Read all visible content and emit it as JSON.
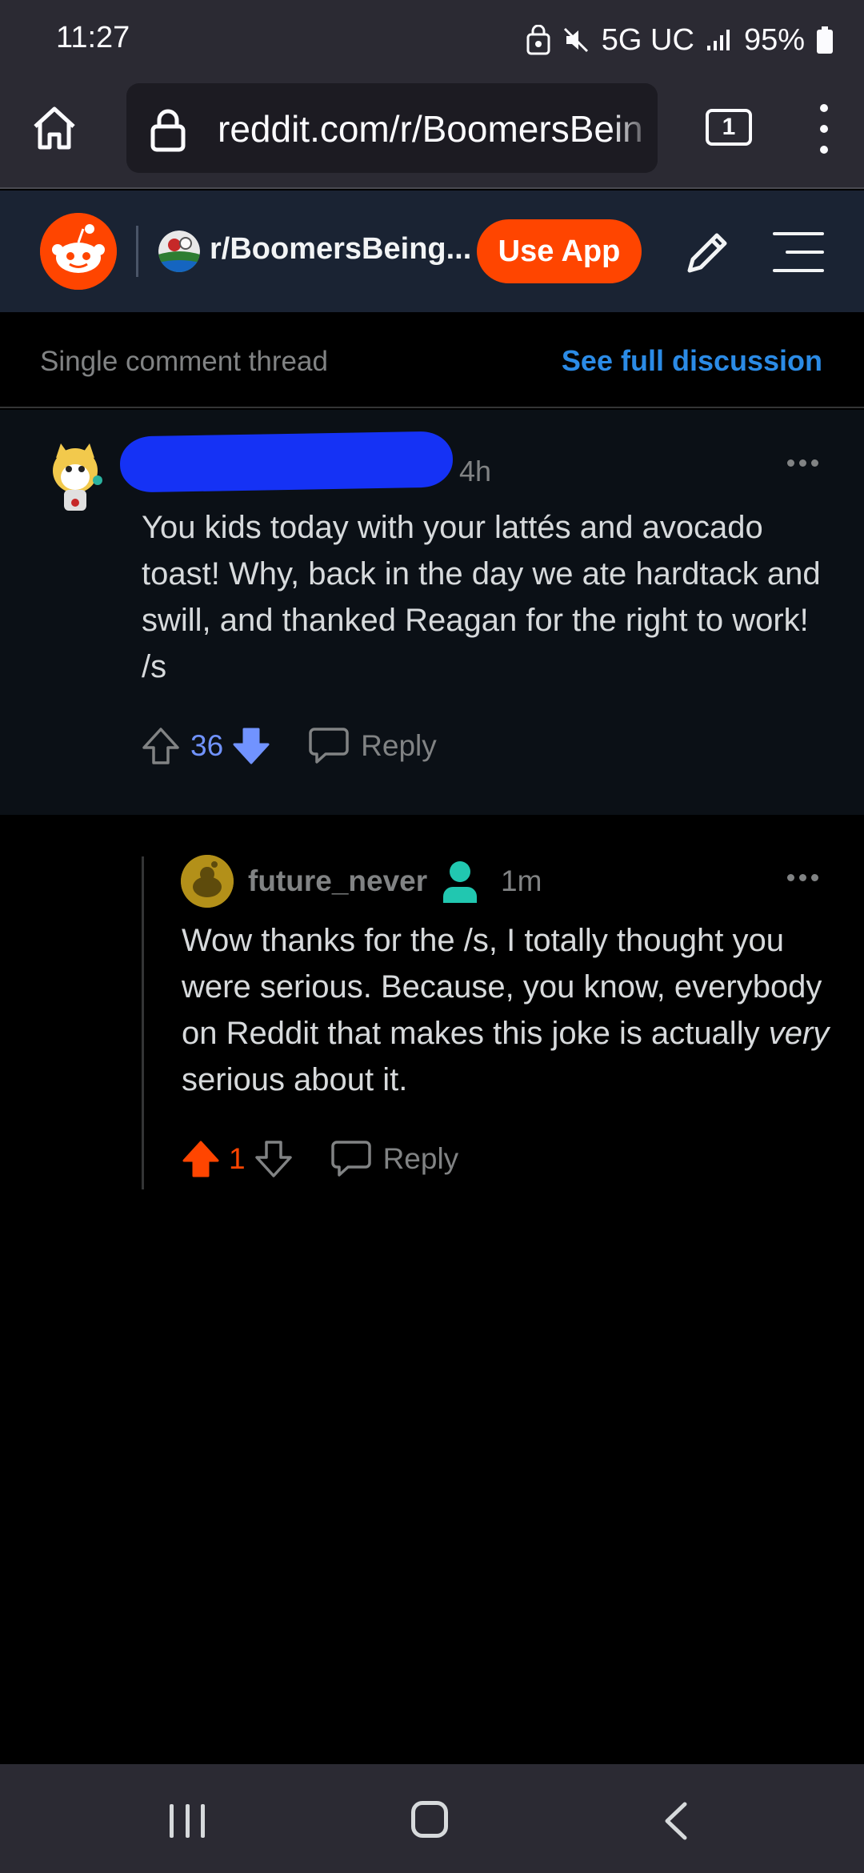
{
  "status_bar": {
    "time": "11:27",
    "network": "5G UC",
    "battery": "95%"
  },
  "browser": {
    "url": "reddit.com/r/BoomersBein",
    "tab_count": "1"
  },
  "reddit_header": {
    "subreddit": "r/BoomersBeing...",
    "use_app_label": "Use App",
    "brand_color": "#ff4500"
  },
  "thread_bar": {
    "label": "Single comment thread",
    "link": "See full discussion"
  },
  "parent_comment": {
    "time": "4h",
    "body": "You kids today with your lattés and avocado toast! Why, back in the day we ate hardtack and swill, and thanked Reagan for the right to work! /s",
    "votes": "36",
    "vote_state": "downvoted",
    "reply_label": "Reply"
  },
  "reply_comment": {
    "username": "future_never",
    "time": "1m",
    "body_before": "Wow thanks for the /s, I totally thought you were serious. Because, you know, everybody on Reddit that makes this joke is actually ",
    "body_emphasis": "very",
    "body_after": " serious about it.",
    "votes": "1",
    "vote_state": "upvoted",
    "reply_label": "Reply"
  },
  "icons": [
    "home-icon",
    "lock-icon",
    "tabs-icon",
    "more-vert-icon",
    "reddit-logo-icon",
    "pencil-icon",
    "hamburger-icon",
    "upvote-icon",
    "downvote-icon",
    "comment-icon",
    "op-user-icon",
    "more-horiz-icon"
  ]
}
